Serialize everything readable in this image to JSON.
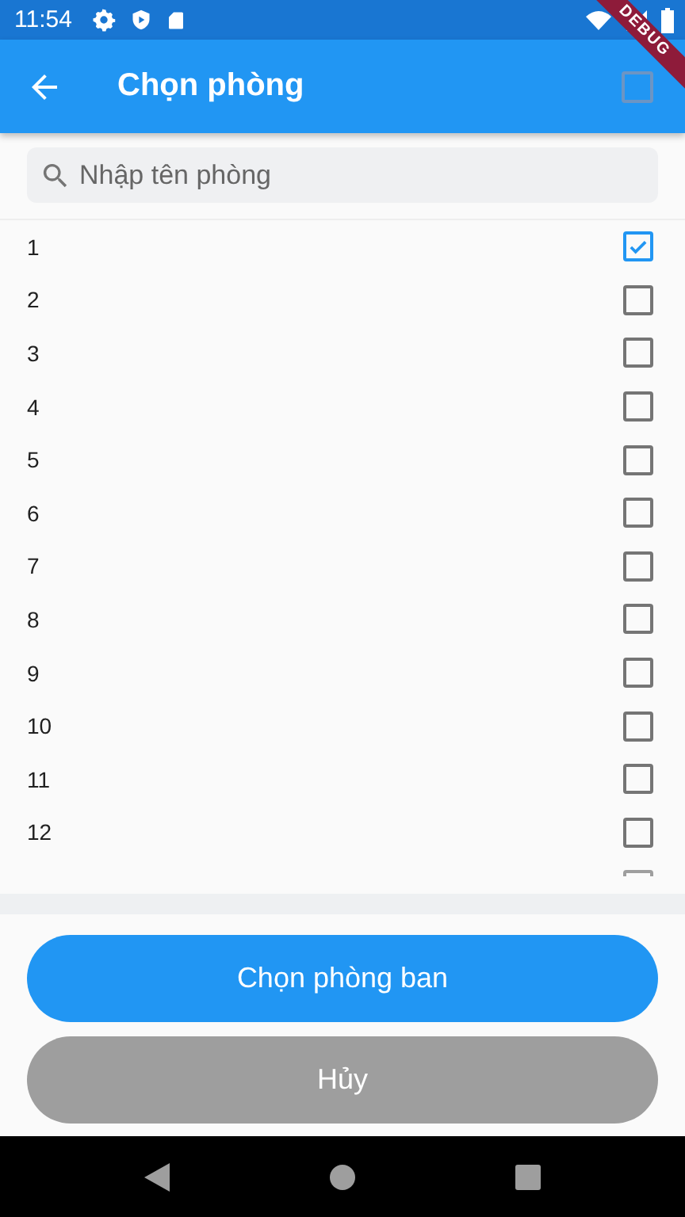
{
  "status_bar": {
    "time": "11:54"
  },
  "debug_banner": "DEBUG",
  "app_bar": {
    "title": "Chọn phòng",
    "select_all": {
      "checked": false
    }
  },
  "search": {
    "placeholder": "Nhập tên phòng"
  },
  "rooms": [
    {
      "label": "1",
      "checked": true
    },
    {
      "label": "2",
      "checked": false
    },
    {
      "label": "3",
      "checked": false
    },
    {
      "label": "4",
      "checked": false
    },
    {
      "label": "5",
      "checked": false
    },
    {
      "label": "6",
      "checked": false
    },
    {
      "label": "7",
      "checked": false
    },
    {
      "label": "8",
      "checked": false
    },
    {
      "label": "9",
      "checked": false
    },
    {
      "label": "10",
      "checked": false
    },
    {
      "label": "11",
      "checked": false
    },
    {
      "label": "12",
      "checked": false
    }
  ],
  "buttons": [
    {
      "label": "Chọn phòng ban",
      "kind": "primary"
    },
    {
      "label": "Hủy",
      "kind": "cancel"
    }
  ]
}
